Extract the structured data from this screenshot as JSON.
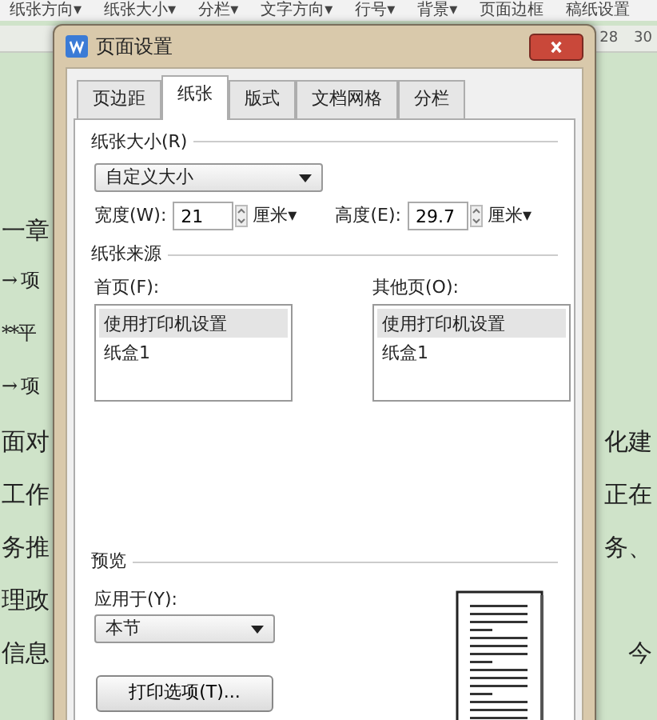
{
  "toolbar": [
    "纸张方向▾",
    "纸张大小▾",
    "分栏▾",
    "文字方向▾",
    "行号▾",
    "背景▾",
    "页面边框",
    "稿纸设置"
  ],
  "ruler": {
    "labels": [
      "28",
      "30"
    ]
  },
  "document": {
    "lines": [
      {
        "left": "一章"
      },
      {
        "left": "→ 项"
      },
      {
        "left": "**平"
      },
      {
        "left": "→ 项"
      },
      {
        "left": "面对",
        "right": "化建"
      },
      {
        "left": "工作",
        "right": "正在"
      },
      {
        "left": "务推",
        "right": "务、"
      },
      {
        "left": "理政"
      },
      {
        "left": "信息",
        "right": "今"
      }
    ]
  },
  "dialog": {
    "title": "页面设置",
    "tabs": [
      {
        "label": "页边距",
        "selected": false
      },
      {
        "label": "纸张",
        "selected": true
      },
      {
        "label": "版式",
        "selected": false
      },
      {
        "label": "文档网格",
        "selected": false
      },
      {
        "label": "分栏",
        "selected": false
      }
    ],
    "paper_size": {
      "heading": "纸张大小(R)",
      "dropdown": "自定义大小",
      "width": {
        "label": "宽度(W):",
        "value": "21",
        "unit": "厘米▾"
      },
      "height": {
        "label": "高度(E):",
        "value": "29.7",
        "unit": "厘米▾"
      }
    },
    "paper_source": {
      "heading": "纸张来源",
      "lists": [
        {
          "label": "首页(F):",
          "items": [
            {
              "text": "使用打印机设置",
              "selected": true
            },
            {
              "text": "纸盒1",
              "selected": false
            }
          ]
        },
        {
          "label": "其他页(O):",
          "items": [
            {
              "text": "使用打印机设置",
              "selected": true
            },
            {
              "text": "纸盒1",
              "selected": false
            }
          ]
        }
      ]
    },
    "preview": {
      "heading": "预览",
      "apply_label": "应用于(Y):",
      "apply_dropdown": "本节"
    },
    "print_button": "打印选项(T)..."
  }
}
